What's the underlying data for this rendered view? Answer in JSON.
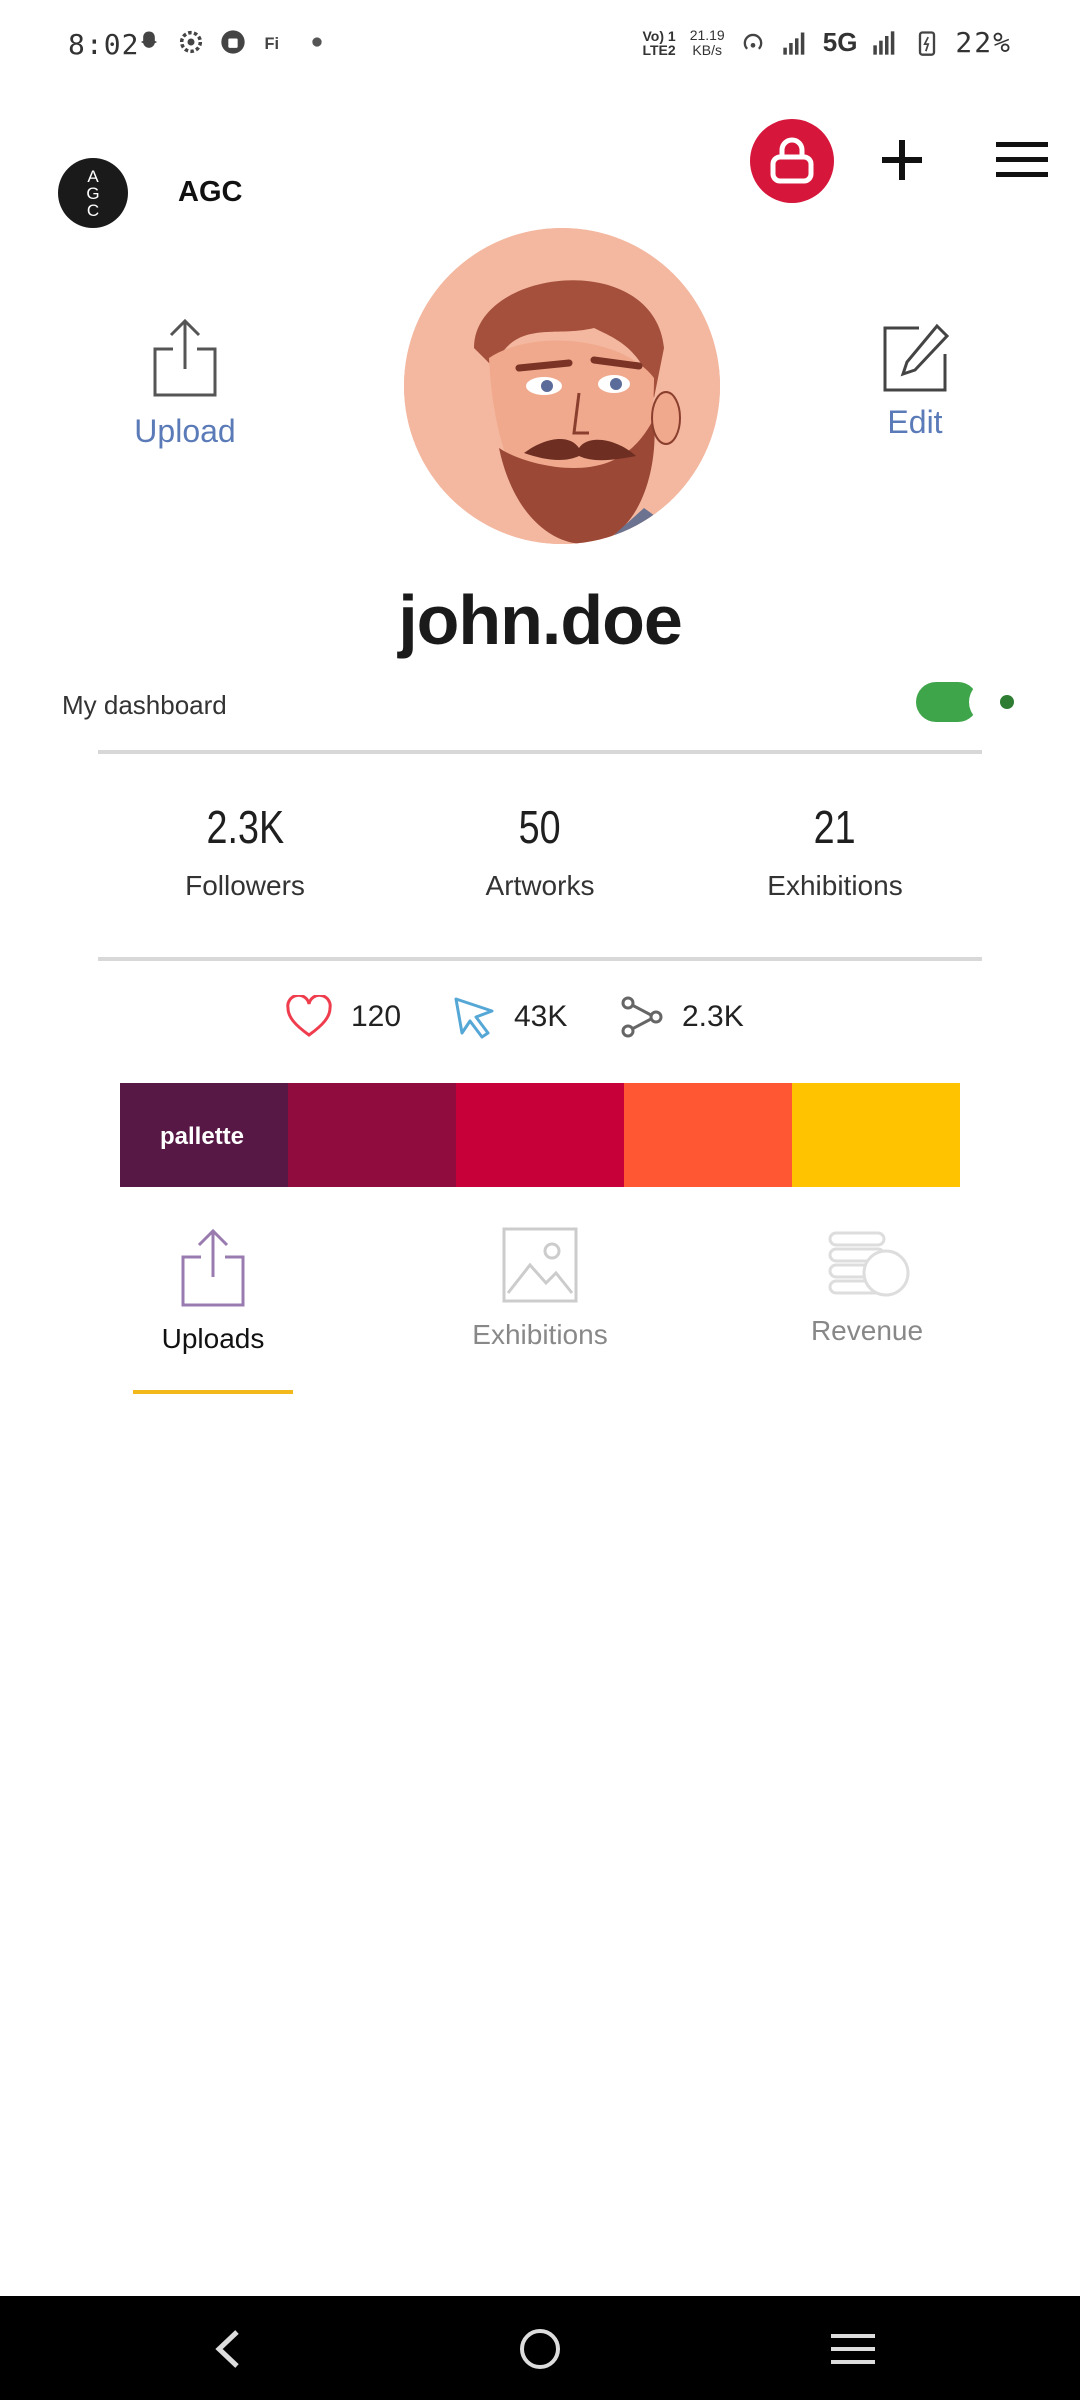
{
  "status": {
    "time": "8:02",
    "network_line1": "Vo) 1",
    "network_line2": "LTE2",
    "speed_line1": "21.19",
    "speed_line2": "KB/s",
    "network_type": "5G",
    "battery": "22%"
  },
  "header": {
    "brand_logo_text": [
      "A",
      "G",
      "C"
    ],
    "brand_name": "AGC"
  },
  "profile": {
    "upload_label": "Upload",
    "edit_label": "Edit",
    "username": "john.doe",
    "dashboard_label": "My dashboard",
    "dashboard_toggle_on": true
  },
  "stats": [
    {
      "value": "2.3K",
      "label": "Followers"
    },
    {
      "value": "50",
      "label": "Artworks"
    },
    {
      "value": "21",
      "label": "Exhibitions"
    }
  ],
  "engagement": {
    "likes": "120",
    "clicks": "43K",
    "shares": "2.3K"
  },
  "palette": {
    "label": "pallette",
    "colors": [
      "#581845",
      "#900C3F",
      "#C70039",
      "#FF5733",
      "#FFC300"
    ]
  },
  "tabs": [
    {
      "label": "Uploads",
      "active": true
    },
    {
      "label": "Exhibitions",
      "active": false
    },
    {
      "label": "Revenue",
      "active": false
    }
  ],
  "colors": {
    "accent_red": "#d6163a",
    "link_blue": "#5a7ab8",
    "toggle_green": "#3ea54a",
    "tab_underline": "#f3b81c"
  }
}
